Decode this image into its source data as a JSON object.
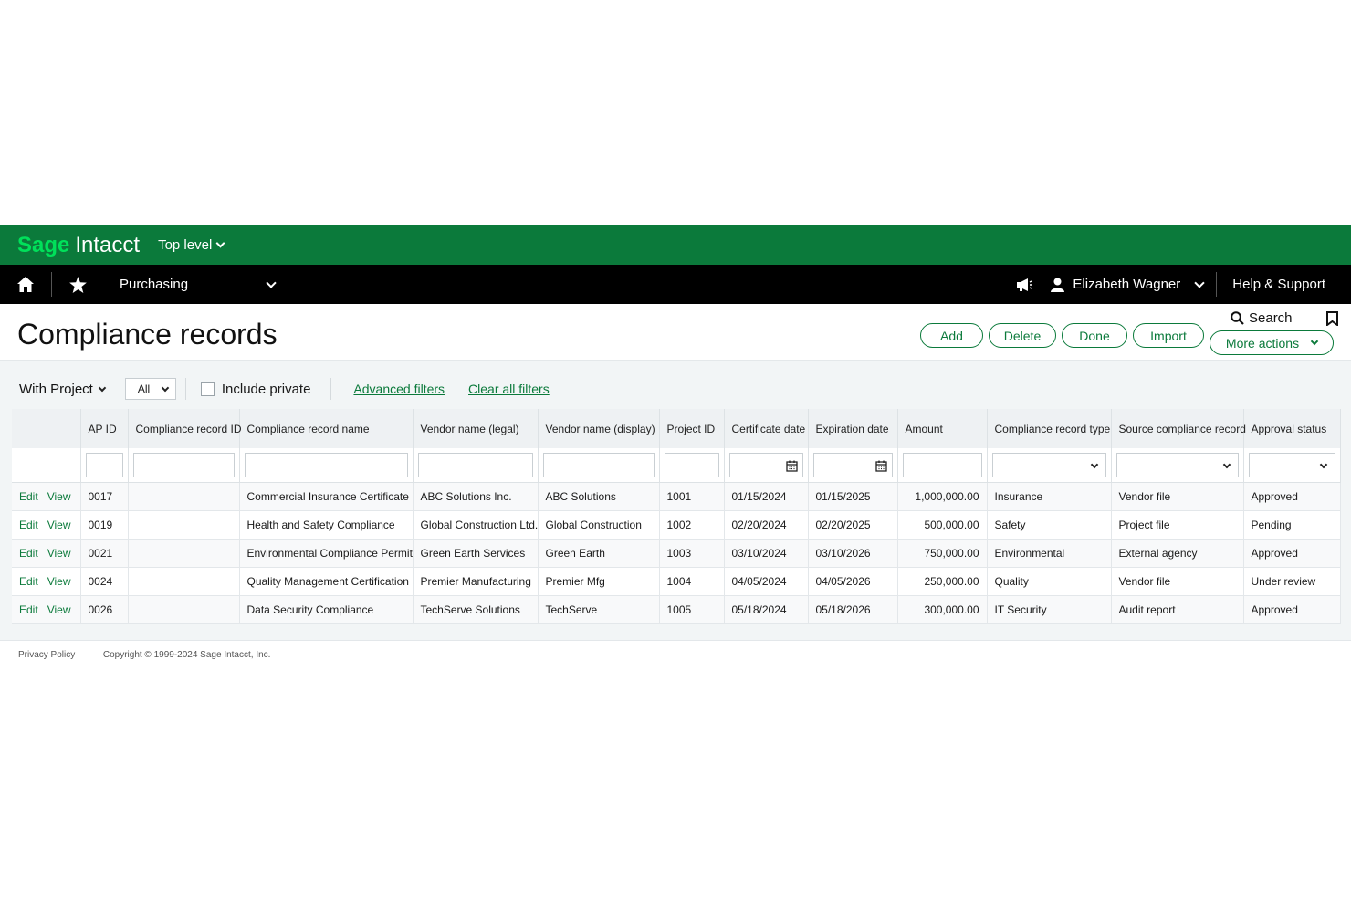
{
  "brand": {
    "sage": "Sage",
    "intacct": "Intacct"
  },
  "level": {
    "label": "Top level"
  },
  "nav": {
    "module": "Purchasing",
    "user": "Elizabeth Wagner",
    "help": "Help & Support",
    "icons": [
      "home-icon",
      "star-icon",
      "megaphone-icon",
      "user-icon"
    ]
  },
  "page": {
    "title": "Compliance records",
    "buttons": {
      "add": "Add",
      "delete": "Delete",
      "done": "Done",
      "import": "Import",
      "more": "More actions"
    },
    "search": "Search"
  },
  "filters": {
    "project": "With Project",
    "all": "All",
    "include_private": "Include private",
    "advanced": "Advanced filters",
    "clear": "Clear all filters"
  },
  "table": {
    "columns": [
      "AP ID",
      "Compliance record ID",
      "Compliance record name",
      "Vendor name (legal)",
      "Vendor name (display)",
      "Project ID",
      "Certificate date",
      "Expiration date",
      "Amount",
      "Compliance record type",
      "Source compliance record",
      "Approval status"
    ],
    "row_actions": {
      "edit": "Edit",
      "view": "View"
    },
    "rows": [
      [
        "0017",
        "",
        "Commercial Insurance Certificate",
        "ABC Solutions Inc.",
        "ABC Solutions",
        "1001",
        "01/15/2024",
        "01/15/2025",
        "1,000,000.00",
        "Insurance",
        "Vendor file",
        "Approved"
      ],
      [
        "0019",
        "",
        "Health and Safety Compliance",
        "Global Construction Ltd.",
        "Global Construction",
        "1002",
        "02/20/2024",
        "02/20/2025",
        "500,000.00",
        "Safety",
        "Project file",
        "Pending"
      ],
      [
        "0021",
        "",
        "Environmental Compliance Permit",
        "Green Earth Services",
        "Green Earth",
        "1003",
        "03/10/2024",
        "03/10/2026",
        "750,000.00",
        "Environmental",
        "External agency",
        "Approved"
      ],
      [
        "0024",
        "",
        "Quality Management Certification",
        "Premier Manufacturing",
        "Premier Mfg",
        "1004",
        "04/05/2024",
        "04/05/2026",
        "250,000.00",
        "Quality",
        "Vendor file",
        "Under review"
      ],
      [
        "0026",
        "",
        "Data Security Compliance",
        "TechServe Solutions",
        "TechServe",
        "1005",
        "05/18/2024",
        "05/18/2026",
        "300,000.00",
        "IT Security",
        "Audit report",
        "Approved"
      ]
    ]
  },
  "footer": {
    "privacy": "Privacy Policy",
    "sep": "|",
    "copyright": "Copyright © 1999-2024 Sage Intacct, Inc."
  },
  "colors": {
    "brand_green": "#0b7a3b",
    "sage_green": "#00e05a",
    "nav_black": "#000000",
    "bg": "#f2f5f6"
  }
}
